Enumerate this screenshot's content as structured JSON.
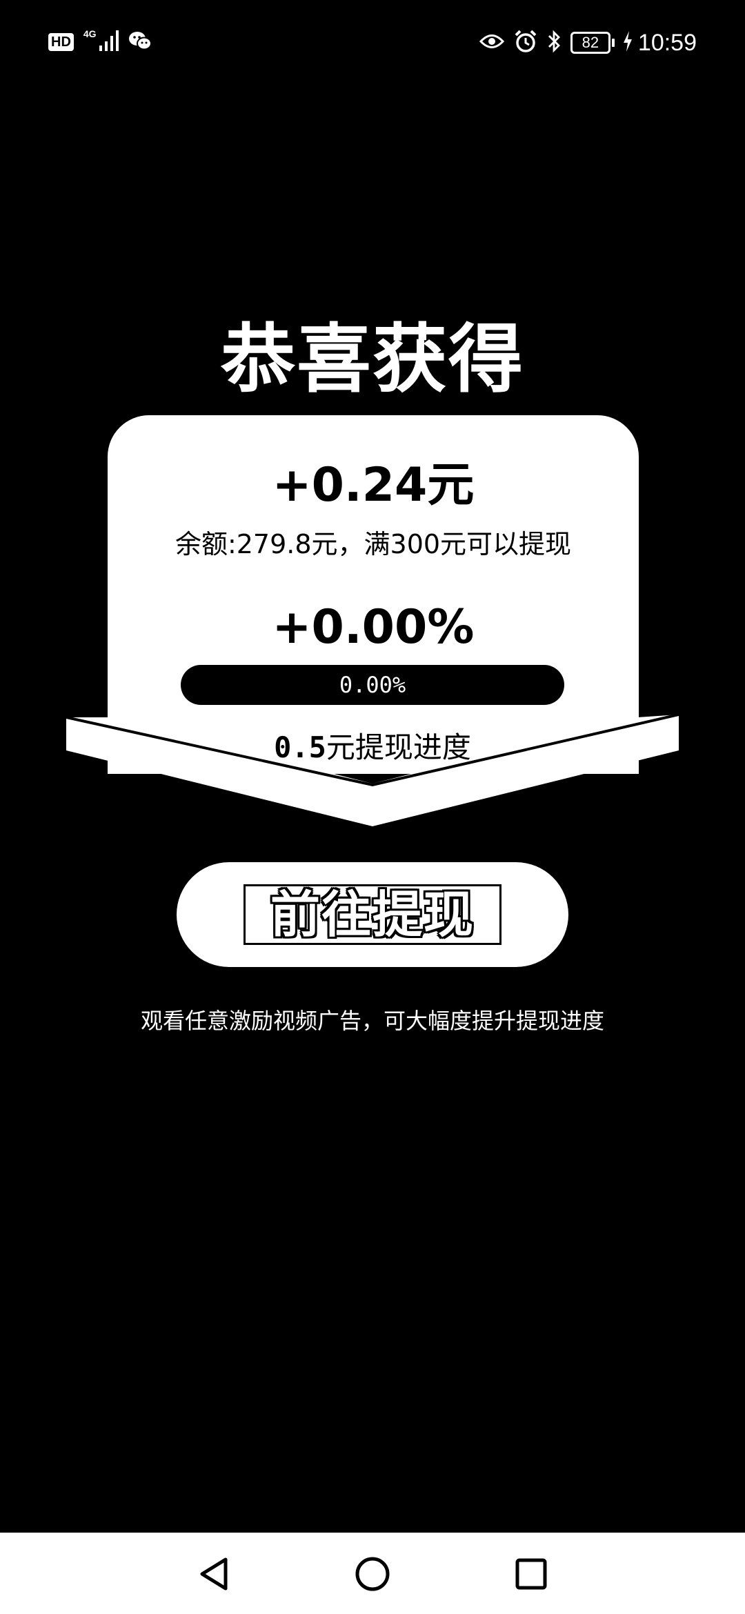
{
  "status_bar": {
    "hd_badge": "HD",
    "network_type": "4G",
    "icons_left": [
      "hd-icon",
      "signal-icon",
      "wechat-icon"
    ],
    "icons_right": [
      "eye-icon",
      "alarm-icon",
      "bluetooth-icon",
      "battery-icon",
      "charging-icon"
    ],
    "battery_level": "82",
    "time": "10:59"
  },
  "reward": {
    "title": "恭喜获得",
    "amount": "+0.24元",
    "balance_text": "余额:279.8元，满300元可以提现",
    "percent": "+0.00%",
    "progress_value": 0,
    "progress_text": "0.00%",
    "caption_number": "0.5",
    "caption_text": "元提现进度"
  },
  "action": {
    "withdraw_label": "前往提现"
  },
  "hint": "观看任意激励视频广告，可大幅度提升提现进度",
  "nav_bar": {
    "buttons": [
      "back-icon",
      "home-icon",
      "recents-icon"
    ]
  },
  "colors": {
    "background": "#000000",
    "card": "#ffffff"
  }
}
